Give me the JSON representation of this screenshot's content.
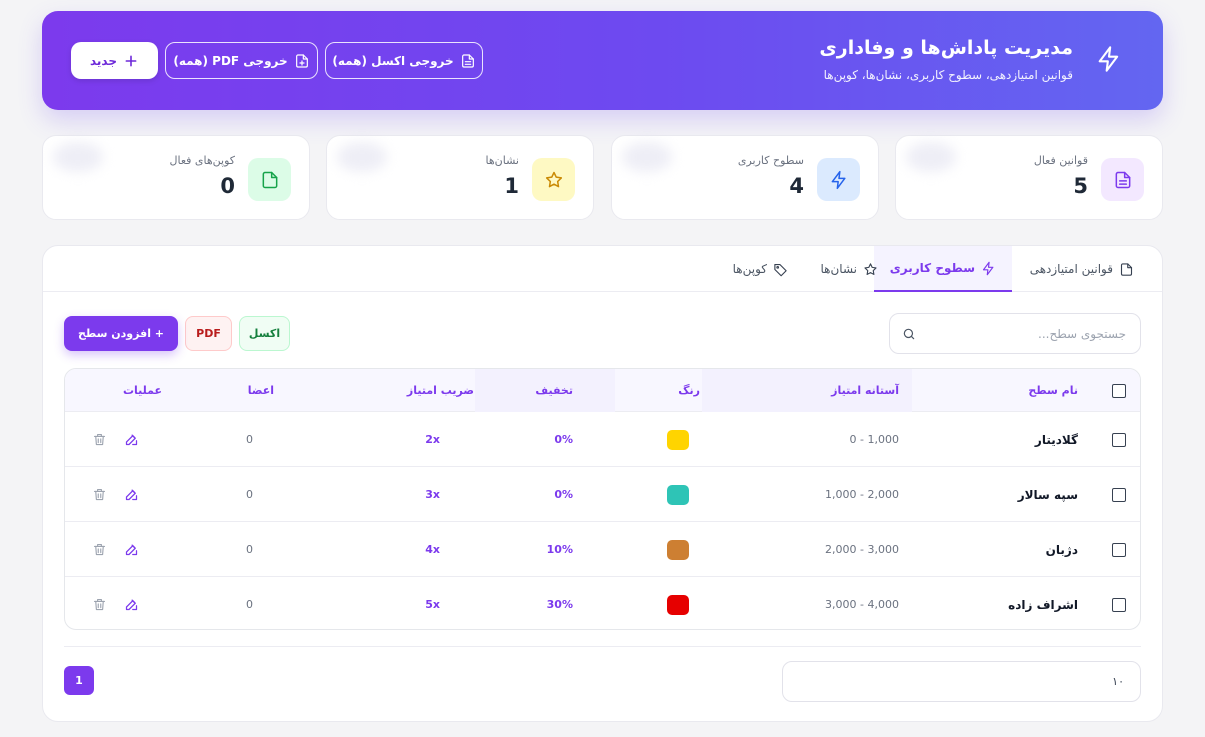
{
  "header": {
    "title": "مدیریت پاداش‌ها و وفاداری",
    "subtitle": "قوانین امتیازدهی، سطوح کاربری، نشان‌ها، کوپن‌ها",
    "icon": "zap-icon",
    "export_excel_label": "خروجی اکسل (همه)",
    "export_pdf_label": "خروجی PDF (همه)",
    "new_label": "جدید",
    "gradient_start": "#7c3aed",
    "gradient_end": "#6366f1"
  },
  "stats": [
    {
      "label": "قوانین فعال",
      "value": "5",
      "icon": "file-text-icon",
      "color": "#7c3aed",
      "bg": "#f3e8ff"
    },
    {
      "label": "سطوح کاربری",
      "value": "4",
      "icon": "zap-icon",
      "color": "#2563eb",
      "bg": "#dbeafe"
    },
    {
      "label": "نشان‌ها",
      "value": "1",
      "icon": "star-icon",
      "color": "#ca8a04",
      "bg": "#fef9c3"
    },
    {
      "label": "کوپن‌های فعال",
      "value": "0",
      "icon": "file-icon",
      "color": "#16a34a",
      "bg": "#dcfce7"
    }
  ],
  "tabs": [
    {
      "label": "قوانین امتیازدهی",
      "icon": "file-icon",
      "active": false
    },
    {
      "label": "سطوح کاربری",
      "icon": "zap-icon",
      "active": true
    },
    {
      "label": "نشان‌ها",
      "icon": "star-icon",
      "active": false
    },
    {
      "label": "کوپن‌ها",
      "icon": "tag-icon",
      "active": false
    }
  ],
  "toolbar": {
    "search_placeholder": "جستجوی سطح...",
    "excel_label": "اکسل",
    "pdf_label": "PDF",
    "add_label": "+ افزودن سطح"
  },
  "table": {
    "headers": [
      "نام سطح",
      "آستانه امتیاز",
      "رنگ",
      "تخفیف",
      "ضریب امتیاز",
      "اعضا",
      "عملیات"
    ],
    "rows": [
      {
        "name": "گلادیتار",
        "range": "0 - 1,000",
        "color": "#ffd400",
        "discount": "0%",
        "multiplier": "2x",
        "members": "0"
      },
      {
        "name": "سپه سالار",
        "range": "1,000 - 2,000",
        "color": "#2ec4b6",
        "discount": "0%",
        "multiplier": "3x",
        "members": "0"
      },
      {
        "name": "دژبان",
        "range": "2,000 - 3,000",
        "color": "#cd7f32",
        "discount": "10%",
        "multiplier": "4x",
        "members": "0"
      },
      {
        "name": "اشراف زاده",
        "range": "3,000 - 4,000",
        "color": "#e60000",
        "discount": "30%",
        "multiplier": "5x",
        "members": "0"
      }
    ]
  },
  "pagination": {
    "page_size": "۱۰",
    "current_page": "1"
  },
  "colors": {
    "accent": "#7c3aed",
    "background": "#f4f4f6"
  }
}
